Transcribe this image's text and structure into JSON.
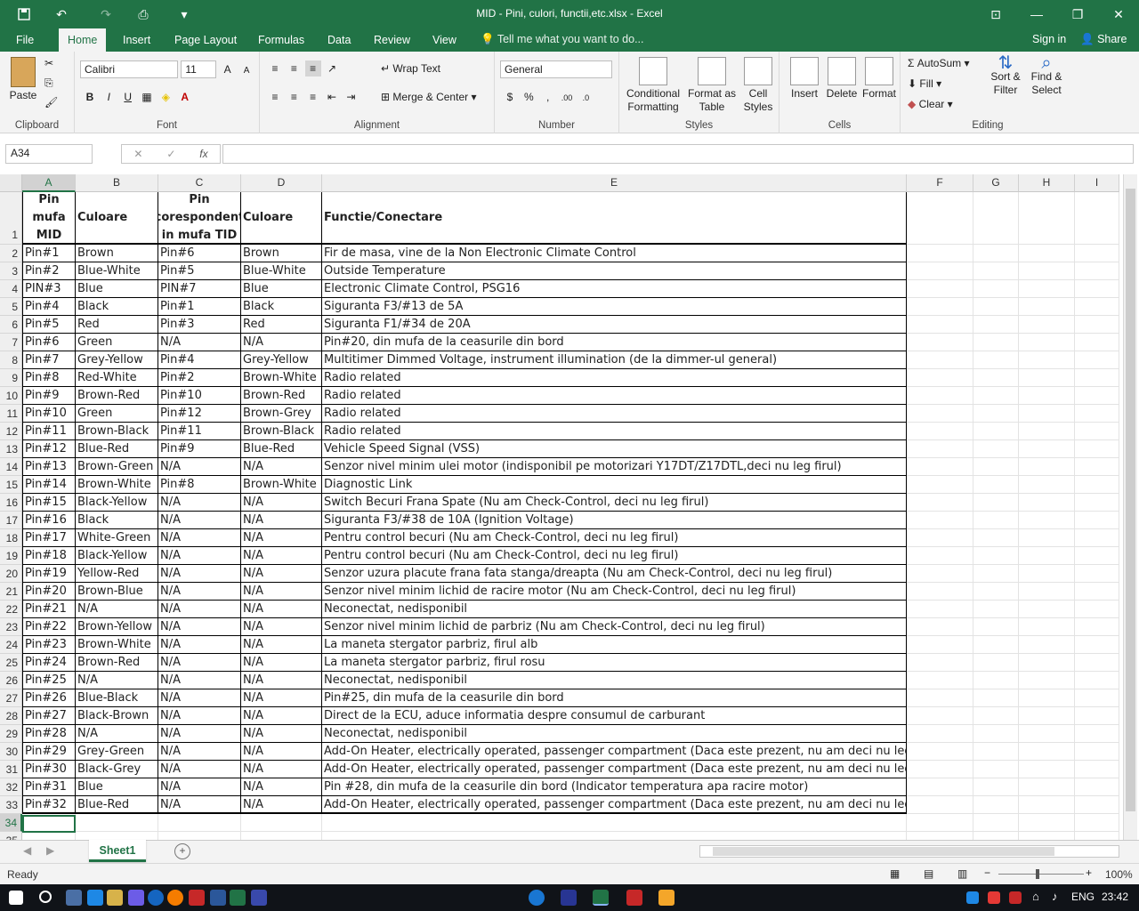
{
  "window": {
    "title": "MID - Pini, culori, functii,etc.xlsx - Excel"
  },
  "tabs": [
    "File",
    "Home",
    "Insert",
    "Page Layout",
    "Formulas",
    "Data",
    "Review",
    "View"
  ],
  "tell_me": "Tell me what you want to do...",
  "signin": "Sign in",
  "share": "Share",
  "ribbon": {
    "clipboard": {
      "label": "Clipboard",
      "paste": "Paste"
    },
    "font": {
      "label": "Font",
      "name": "Calibri",
      "size": "11",
      "bold": "B",
      "italic": "I",
      "underline": "U"
    },
    "alignment": {
      "label": "Alignment",
      "wrap": "Wrap Text",
      "merge": "Merge & Center"
    },
    "number": {
      "label": "Number",
      "format": "General",
      "currency": "$",
      "percent": "%",
      "comma": ","
    },
    "styles": {
      "label": "Styles",
      "cond1": "Conditional",
      "cond2": "Formatting",
      "fmt1": "Format as",
      "fmt2": "Table",
      "cell1": "Cell",
      "cell2": "Styles"
    },
    "cells": {
      "label": "Cells",
      "insert": "Insert",
      "delete": "Delete",
      "format": "Format"
    },
    "editing": {
      "label": "Editing",
      "autosum": "AutoSum",
      "fill": "Fill",
      "clear": "Clear",
      "sort1": "Sort &",
      "sort2": "Filter",
      "find1": "Find &",
      "find2": "Select"
    }
  },
  "formula_bar": {
    "name_box": "A34",
    "fx": "fx",
    "value": ""
  },
  "columns": [
    "A",
    "B",
    "C",
    "D",
    "E",
    "F",
    "G",
    "H",
    "I"
  ],
  "header_row": [
    "Pin mufa MID",
    "Culoare",
    "Pin corespondent in mufa TID",
    "Culoare",
    "Functie/Conectare"
  ],
  "rows": [
    [
      "Pin#1",
      "Brown",
      "Pin#6",
      "Brown",
      "Fir de masa, vine de la Non Electronic Climate Control"
    ],
    [
      "Pin#2",
      "Blue-White",
      "Pin#5",
      "Blue-White",
      "Outside Temperature"
    ],
    [
      "PIN#3",
      "Blue",
      "PIN#7",
      "Blue",
      "Electronic Climate Control, PSG16"
    ],
    [
      "Pin#4",
      "Black",
      "Pin#1",
      "Black",
      "Siguranta F3/#13 de 5A"
    ],
    [
      "Pin#5",
      "Red",
      "Pin#3",
      "Red",
      "Siguranta F1/#34 de 20A"
    ],
    [
      "Pin#6",
      "Green",
      "N/A",
      "N/A",
      "Pin#20, din mufa de la ceasurile din bord"
    ],
    [
      "Pin#7",
      "Grey-Yellow",
      "Pin#4",
      "Grey-Yellow",
      "Multitimer Dimmed Voltage, instrument illumination (de la dimmer-ul general)"
    ],
    [
      "Pin#8",
      "Red-White",
      "Pin#2",
      "Brown-White",
      "Radio related"
    ],
    [
      "Pin#9",
      "Brown-Red",
      "Pin#10",
      "Brown-Red",
      "Radio related"
    ],
    [
      "Pin#10",
      "Green",
      "Pin#12",
      "Brown-Grey",
      "Radio related"
    ],
    [
      "Pin#11",
      "Brown-Black",
      "Pin#11",
      "Brown-Black",
      "Radio related"
    ],
    [
      "Pin#12",
      "Blue-Red",
      "Pin#9",
      "Blue-Red",
      "Vehicle Speed Signal (VSS)"
    ],
    [
      "Pin#13",
      "Brown-Green",
      "N/A",
      "N/A",
      "Senzor nivel minim ulei motor (indisponibil pe motorizari Y17DT/Z17DTL,deci nu leg firul)"
    ],
    [
      "Pin#14",
      "Brown-White",
      "Pin#8",
      "Brown-White",
      "Diagnostic Link"
    ],
    [
      "Pin#15",
      "Black-Yellow",
      "N/A",
      "N/A",
      "Switch Becuri Frana Spate (Nu am Check-Control, deci nu leg firul)"
    ],
    [
      "Pin#16",
      "Black",
      "N/A",
      "N/A",
      "Siguranta F3/#38 de 10A (Ignition Voltage)"
    ],
    [
      "Pin#17",
      "White-Green",
      "N/A",
      "N/A",
      "Pentru control becuri (Nu am Check-Control, deci nu leg firul)"
    ],
    [
      "Pin#18",
      "Black-Yellow",
      "N/A",
      "N/A",
      "Pentru control becuri (Nu am Check-Control, deci nu leg firul)"
    ],
    [
      "Pin#19",
      "Yellow-Red",
      "N/A",
      "N/A",
      "Senzor uzura placute frana fata stanga/dreapta (Nu am Check-Control, deci nu leg firul)"
    ],
    [
      "Pin#20",
      "Brown-Blue",
      "N/A",
      "N/A",
      "Senzor nivel minim lichid de racire motor (Nu am Check-Control, deci nu leg firul)"
    ],
    [
      "Pin#21",
      "N/A",
      "N/A",
      "N/A",
      "Neconectat, nedisponibil"
    ],
    [
      "Pin#22",
      "Brown-Yellow",
      "N/A",
      "N/A",
      "Senzor nivel minim lichid de parbriz (Nu am Check-Control, deci nu leg firul)"
    ],
    [
      "Pin#23",
      "Brown-White",
      "N/A",
      "N/A",
      "La maneta stergator parbriz, firul alb"
    ],
    [
      "Pin#24",
      "Brown-Red",
      "N/A",
      "N/A",
      "La maneta stergator parbriz, firul rosu"
    ],
    [
      "Pin#25",
      "N/A",
      "N/A",
      "N/A",
      "Neconectat, nedisponibil"
    ],
    [
      "Pin#26",
      "Blue-Black",
      "N/A",
      "N/A",
      "Pin#25, din mufa de la ceasurile din bord"
    ],
    [
      "Pin#27",
      "Black-Brown",
      "N/A",
      "N/A",
      "Direct de la ECU, aduce informatia despre consumul de carburant"
    ],
    [
      "Pin#28",
      "N/A",
      "N/A",
      "N/A",
      "Neconectat, nedisponibil"
    ],
    [
      "Pin#29",
      "Grey-Green",
      "N/A",
      "N/A",
      "Add-On Heater, electrically operated, passenger compartment (Daca este prezent, nu am deci nu leg firul)"
    ],
    [
      "Pin#30",
      "Black-Grey",
      "N/A",
      "N/A",
      "Add-On Heater, electrically operated, passenger compartment (Daca este prezent, nu am deci nu leg firul)"
    ],
    [
      "Pin#31",
      "Blue",
      "N/A",
      "N/A",
      "Pin #28, din mufa de la ceasurile din bord (Indicator temperatura apa racire motor)"
    ],
    [
      "Pin#32",
      "Blue-Red",
      "N/A",
      "N/A",
      "Add-On Heater, electrically operated, passenger compartment (Daca este prezent, nu am deci nu leg firul)"
    ]
  ],
  "sheet_tab": "Sheet1",
  "status": {
    "ready": "Ready",
    "zoom": "100%"
  },
  "taskbar": {
    "lang": "ENG",
    "time": "23:42"
  },
  "colors": {
    "accent": "#217346"
  }
}
